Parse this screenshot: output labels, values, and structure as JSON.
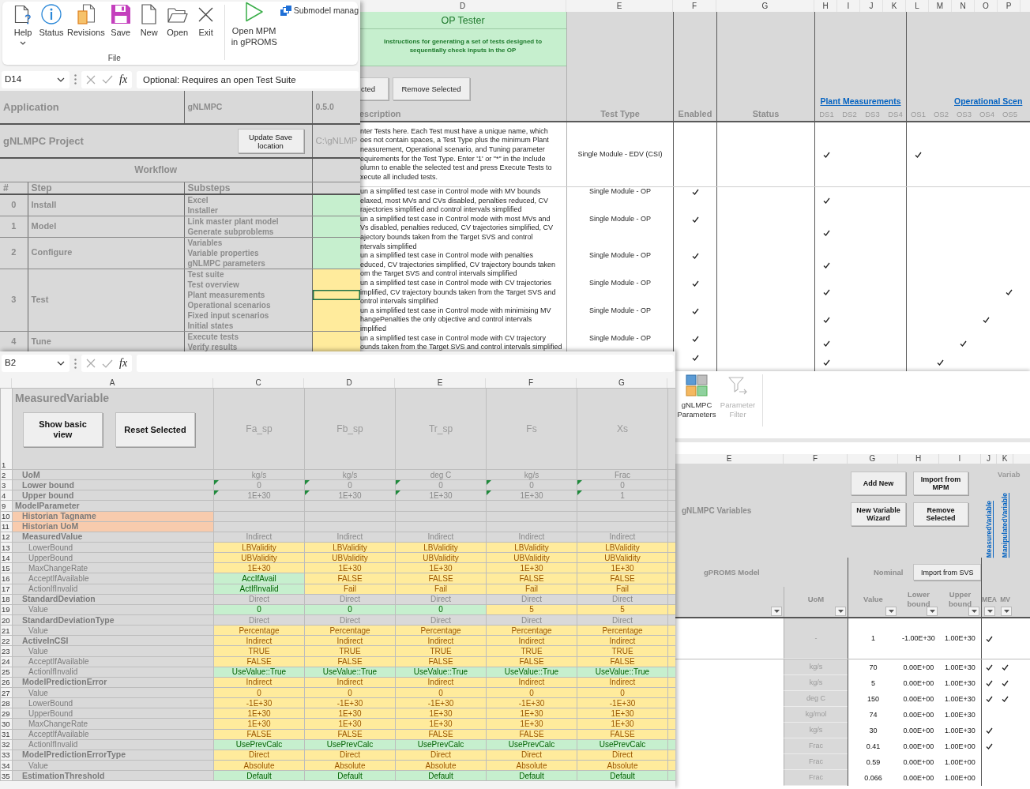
{
  "workflow_window": {
    "ribbon": {
      "commands": [
        {
          "kind": "help",
          "label": "Help",
          "dropdown": true
        },
        {
          "kind": "status",
          "label": "Status",
          "dropdown": false
        },
        {
          "kind": "revisions",
          "label": "Revisions",
          "dropdown": false
        },
        {
          "kind": "save",
          "label": "Save",
          "dropdown": false
        },
        {
          "kind": "new",
          "label": "New",
          "dropdown": false
        },
        {
          "kind": "open",
          "label": "Open",
          "dropdown": false
        },
        {
          "kind": "exit",
          "label": "Exit",
          "dropdown": false
        }
      ],
      "group_label": "File",
      "run_command": "Open MPM in gPROMS",
      "submodel_command": "Submodel manag"
    },
    "formula_bar": {
      "cell": "D14",
      "function_label": "fx",
      "formula": "Optional: Requires an open Test Suite"
    },
    "application_row": {
      "label": "Application",
      "value": "gNLMPC",
      "version": "0.5.0"
    },
    "project_row": {
      "label": "gNLMPC Project",
      "button": "Update Save location",
      "path": "C:\\gNLMP"
    },
    "section_title": "Workflow",
    "columns": [
      "#",
      "Step",
      "Substeps"
    ],
    "steps": [
      {
        "number": "0",
        "name": "Install",
        "color": "#c6efce",
        "substeps": [
          {
            "label": "Excel",
            "selected": false
          },
          {
            "label": "Installer",
            "selected": false
          }
        ]
      },
      {
        "number": "1",
        "name": "Model",
        "color": "#c6efce",
        "substeps": [
          {
            "label": "Link master plant model",
            "selected": false
          },
          {
            "label": "Generate subproblems",
            "selected": false
          }
        ]
      },
      {
        "number": "2",
        "name": "Configure",
        "color": "#c6efce",
        "substeps": [
          {
            "label": "Variables",
            "selected": false
          },
          {
            "label": "Variable properties",
            "selected": false
          },
          {
            "label": "gNLMPC parameters",
            "selected": false
          }
        ]
      },
      {
        "number": "3",
        "name": "Test",
        "color": "#ffeb9c",
        "substeps": [
          {
            "label": "Test suite",
            "selected": false
          },
          {
            "label": "Test overview",
            "selected": false
          },
          {
            "label": "Plant measurements",
            "selected": true
          },
          {
            "label": "Operational scenarios",
            "selected": false
          },
          {
            "label": "Fixed input scenarios",
            "selected": false
          },
          {
            "label": "Initial states",
            "selected": false
          }
        ]
      },
      {
        "number": "4",
        "name": "Tune",
        "color": "#ffeb9c",
        "substeps": [
          {
            "label": "Execute tests",
            "selected": false
          },
          {
            "label": "Verify results",
            "selected": false
          }
        ]
      }
    ]
  },
  "test_window": {
    "column_letters": [
      "D",
      "E",
      "F",
      "G",
      "H",
      "I",
      "J",
      "K",
      "L",
      "M",
      "N",
      "O",
      "P"
    ],
    "title": "OP Tester",
    "instructions": "Instructions for generating a set of tests designed to sequentially check inputs in the OP",
    "buttons": [
      "cted",
      "Remove Selected"
    ],
    "headers": {
      "description": "escription",
      "test_type": "Test Type",
      "enabled": "Enabled",
      "status": "Status"
    },
    "plant_link": "Plant Measurements",
    "plant_columns": [
      "DS1",
      "DS2",
      "DS3",
      "DS4"
    ],
    "scenario_link": "Operational Scen",
    "scenario_columns": [
      "OS1",
      "OS2",
      "OS3",
      "OS4",
      "OS5"
    ],
    "tests": [
      {
        "description": [
          "nter Tests here. Each Test must have a unique name, which",
          "oes not contain spaces, a Test Type plus the minimum Plant",
          "neasurement, Operational scenario, and Tuning parameter",
          "equirements for the Test Type. Enter '1' or \"*\" in the Include",
          "olumn to enable the selected test and press Execute Tests to",
          "xecute all included tests."
        ],
        "test_type": "Single Module - EDV (CSI)",
        "enabled": false,
        "plant": [
          true,
          false,
          false,
          false
        ],
        "scenarios": [
          true,
          false,
          false,
          false,
          false
        ]
      },
      {
        "description": [
          "un a simplified test case in Control mode with MV bounds",
          "elaxed, most MVs and CVs disabled, penalties reduced, CV",
          "rajectories simplified and control intervals simplified"
        ],
        "test_type": "Single Module - OP",
        "enabled": true,
        "plant": [
          true,
          false,
          false,
          false
        ],
        "scenarios": [
          false,
          false,
          false,
          false,
          false
        ]
      },
      {
        "description": [
          "un a simplified test case in Control mode with most MVs and",
          "Vs disabled, penalties reduced, CV trajectories simplified, CV",
          "ajectory bounds taken from the Target SVS and control",
          "ntervals simplified"
        ],
        "test_type": "Single Module - OP",
        "enabled": true,
        "plant": [
          true,
          false,
          false,
          false
        ],
        "scenarios": [
          false,
          false,
          false,
          false,
          false
        ]
      },
      {
        "description": [
          "un a simplified test case in Control mode with penalties",
          "educed, CV trajectories simplified, CV trajectory bounds taken",
          "om the Target SVS and control intervals simplified"
        ],
        "test_type": "Single Module - OP",
        "enabled": true,
        "plant": [
          true,
          false,
          false,
          false
        ],
        "scenarios": [
          false,
          false,
          false,
          false,
          false
        ]
      },
      {
        "description": [
          "un a simplified test case in Control mode with CV trajectories",
          "implified, CV trajectory bounds taken from the Target SVS and",
          "ontrol intervals simplified"
        ],
        "test_type": "Single Module - OP",
        "enabled": true,
        "plant": [
          true,
          false,
          false,
          false
        ],
        "scenarios": [
          false,
          false,
          false,
          false,
          true
        ]
      },
      {
        "description": [
          "un a simplified test case in Control mode with minimising MV",
          "hangePenalties the only objective and control intervals",
          "implified"
        ],
        "test_type": "Single Module - OP",
        "enabled": true,
        "plant": [
          true,
          false,
          false,
          false
        ],
        "scenarios": [
          false,
          false,
          false,
          true,
          false
        ]
      },
      {
        "description": [
          "un a simplified test case in Control mode with CV trajectory",
          "ounds taken from the Target SVS and control intervals simplified"
        ],
        "test_type": "Single Module - OP",
        "enabled": true,
        "plant": [
          true,
          false,
          false,
          false
        ],
        "scenarios": [
          false,
          false,
          true,
          false,
          false
        ]
      },
      {
        "enabled": true,
        "plant": [
          true,
          false,
          false,
          false
        ],
        "scenarios": [
          false,
          true,
          false,
          false,
          false
        ]
      }
    ]
  },
  "variable_window": {
    "formula_bar": {
      "cell": "B2",
      "function_label": "fx"
    },
    "column_letters": [
      "A",
      "C",
      "D",
      "E",
      "F",
      "G"
    ],
    "header_row_number": "1",
    "title": "MeasuredVariable",
    "buttons": [
      "Show basic view",
      "Reset Selected"
    ],
    "variables": [
      "Fa_sp",
      "Fb_sp",
      "Tr_sp",
      "Fs",
      "Xs"
    ],
    "rows": [
      {
        "number": "2",
        "label": "UoM",
        "kind": "property",
        "flagged": false,
        "cells": [
          {
            "text": "kg/s",
            "color": "#d9d9d9"
          },
          {
            "text": "kg/s",
            "color": "#d9d9d9"
          },
          {
            "text": "deg C",
            "color": "#d9d9d9"
          },
          {
            "text": "kg/s",
            "color": "#d9d9d9"
          },
          {
            "text": "Frac",
            "color": "#d9d9d9"
          }
        ]
      },
      {
        "number": "3",
        "label": "Lower bound",
        "kind": "property",
        "flagged": true,
        "cells": [
          {
            "text": "0",
            "color": "#d9d9d9"
          },
          {
            "text": "0",
            "color": "#d9d9d9"
          },
          {
            "text": "0",
            "color": "#d9d9d9"
          },
          {
            "text": "0",
            "color": "#d9d9d9"
          },
          {
            "text": "0",
            "color": "#d9d9d9"
          }
        ]
      },
      {
        "number": "4",
        "label": "Upper bound",
        "kind": "property",
        "flagged": true,
        "cells": [
          {
            "text": "1E+30",
            "color": "#d9d9d9"
          },
          {
            "text": "1E+30",
            "color": "#d9d9d9"
          },
          {
            "text": "1E+30",
            "color": "#d9d9d9"
          },
          {
            "text": "1E+30",
            "color": "#d9d9d9"
          },
          {
            "text": "1",
            "color": "#d9d9d9"
          }
        ]
      },
      {
        "number": "9",
        "label": "ModelParameter",
        "kind": "heading",
        "flagged": false
      },
      {
        "number": "10",
        "label": "Historian Tagname",
        "kind": "property",
        "flagged": false,
        "color": "#f8cbad"
      },
      {
        "number": "11",
        "label": "Historian UoM",
        "kind": "property",
        "flagged": false,
        "color": "#f8cbad"
      },
      {
        "number": "12",
        "label": "MeasuredValue",
        "kind": "property",
        "flagged": false,
        "cells": [
          {
            "text": "Indirect",
            "color": "#d9d9d9"
          },
          {
            "text": "Indirect",
            "color": "#d9d9d9"
          },
          {
            "text": "Indirect",
            "color": "#d9d9d9"
          },
          {
            "text": "Indirect",
            "color": "#d9d9d9"
          },
          {
            "text": "Indirect",
            "color": "#d9d9d9"
          }
        ]
      },
      {
        "number": "13",
        "label": "LowerBound",
        "kind": "field",
        "flagged": false,
        "cells": [
          {
            "text": "LBValidity",
            "color": "#ffeb9c"
          },
          {
            "text": "LBValidity",
            "color": "#ffeb9c"
          },
          {
            "text": "LBValidity",
            "color": "#ffeb9c"
          },
          {
            "text": "LBValidity",
            "color": "#ffeb9c"
          },
          {
            "text": "LBValidity",
            "color": "#ffeb9c"
          }
        ]
      },
      {
        "number": "14",
        "label": "UpperBound",
        "kind": "field",
        "flagged": false,
        "cells": [
          {
            "text": "UBValidity",
            "color": "#ffeb9c"
          },
          {
            "text": "UBValidity",
            "color": "#ffeb9c"
          },
          {
            "text": "UBValidity",
            "color": "#ffeb9c"
          },
          {
            "text": "UBValidity",
            "color": "#ffeb9c"
          },
          {
            "text": "UBValidity",
            "color": "#ffeb9c"
          }
        ]
      },
      {
        "number": "15",
        "label": "MaxChangeRate",
        "kind": "field",
        "flagged": false,
        "cells": [
          {
            "text": "1E+30",
            "color": "#ffeb9c"
          },
          {
            "text": "1E+30",
            "color": "#ffeb9c"
          },
          {
            "text": "1E+30",
            "color": "#ffeb9c"
          },
          {
            "text": "1E+30",
            "color": "#ffeb9c"
          },
          {
            "text": "1E+30",
            "color": "#ffeb9c"
          }
        ]
      },
      {
        "number": "16",
        "label": "AcceptIfAvailable",
        "kind": "field",
        "flagged": false,
        "cells": [
          {
            "text": "AccIfAvail",
            "color": "#c6efce"
          },
          {
            "text": "FALSE",
            "color": "#ffeb9c"
          },
          {
            "text": "FALSE",
            "color": "#ffeb9c"
          },
          {
            "text": "FALSE",
            "color": "#ffeb9c"
          },
          {
            "text": "FALSE",
            "color": "#ffeb9c"
          }
        ]
      },
      {
        "number": "17",
        "label": "ActionIfInvalid",
        "kind": "field",
        "flagged": false,
        "cells": [
          {
            "text": "ActIfInvalid",
            "color": "#c6efce"
          },
          {
            "text": "Fail",
            "color": "#ffeb9c"
          },
          {
            "text": "Fail",
            "color": "#ffeb9c"
          },
          {
            "text": "Fail",
            "color": "#ffeb9c"
          },
          {
            "text": "Fail",
            "color": "#ffeb9c"
          }
        ]
      },
      {
        "number": "18",
        "label": "StandardDeviation",
        "kind": "property",
        "flagged": false,
        "cells": [
          {
            "text": "Direct",
            "color": "#d9d9d9"
          },
          {
            "text": "Direct",
            "color": "#d9d9d9"
          },
          {
            "text": "Direct",
            "color": "#d9d9d9"
          },
          {
            "text": "Direct",
            "color": "#d9d9d9"
          },
          {
            "text": "Direct",
            "color": "#d9d9d9"
          }
        ]
      },
      {
        "number": "19",
        "label": "Value",
        "kind": "field",
        "flagged": false,
        "cells": [
          {
            "text": "0",
            "color": "#c6efce"
          },
          {
            "text": "0",
            "color": "#c6efce"
          },
          {
            "text": "0",
            "color": "#c6efce"
          },
          {
            "text": "5",
            "color": "#ffeb9c"
          },
          {
            "text": "5",
            "color": "#ffeb9c"
          }
        ]
      },
      {
        "number": "20",
        "label": "StandardDeviationType",
        "kind": "property",
        "flagged": false,
        "cells": [
          {
            "text": "Direct",
            "color": "#d9d9d9"
          },
          {
            "text": "Direct",
            "color": "#d9d9d9"
          },
          {
            "text": "Direct",
            "color": "#d9d9d9"
          },
          {
            "text": "Direct",
            "color": "#d9d9d9"
          },
          {
            "text": "Direct",
            "color": "#d9d9d9"
          }
        ]
      },
      {
        "number": "21",
        "label": "Value",
        "kind": "field",
        "flagged": false,
        "cells": [
          {
            "text": "Percentage",
            "color": "#ffeb9c"
          },
          {
            "text": "Percentage",
            "color": "#ffeb9c"
          },
          {
            "text": "Percentage",
            "color": "#ffeb9c"
          },
          {
            "text": "Percentage",
            "color": "#ffeb9c"
          },
          {
            "text": "Percentage",
            "color": "#ffeb9c"
          }
        ]
      },
      {
        "number": "22",
        "label": "ActiveInCSI",
        "kind": "property",
        "flagged": false,
        "cells": [
          {
            "text": "Indirect",
            "color": "#ffeb9c"
          },
          {
            "text": "Indirect",
            "color": "#ffeb9c"
          },
          {
            "text": "Indirect",
            "color": "#ffeb9c"
          },
          {
            "text": "Indirect",
            "color": "#ffeb9c"
          },
          {
            "text": "Indirect",
            "color": "#ffeb9c"
          }
        ]
      },
      {
        "number": "23",
        "label": "Value",
        "kind": "field",
        "flagged": false,
        "cells": [
          {
            "text": "TRUE",
            "color": "#ffeb9c"
          },
          {
            "text": "TRUE",
            "color": "#ffeb9c"
          },
          {
            "text": "TRUE",
            "color": "#ffeb9c"
          },
          {
            "text": "TRUE",
            "color": "#ffeb9c"
          },
          {
            "text": "TRUE",
            "color": "#ffeb9c"
          }
        ]
      },
      {
        "number": "24",
        "label": "AcceptIfAvailable",
        "kind": "field",
        "flagged": false,
        "cells": [
          {
            "text": "FALSE",
            "color": "#ffeb9c"
          },
          {
            "text": "FALSE",
            "color": "#ffeb9c"
          },
          {
            "text": "FALSE",
            "color": "#ffeb9c"
          },
          {
            "text": "FALSE",
            "color": "#ffeb9c"
          },
          {
            "text": "FALSE",
            "color": "#ffeb9c"
          }
        ]
      },
      {
        "number": "25",
        "label": "ActionIfInvalid",
        "kind": "field",
        "flagged": false,
        "cells": [
          {
            "text": "UseValue::True",
            "color": "#c6efce"
          },
          {
            "text": "UseValue::True",
            "color": "#c6efce"
          },
          {
            "text": "UseValue::True",
            "color": "#c6efce"
          },
          {
            "text": "UseValue::True",
            "color": "#c6efce"
          },
          {
            "text": "UseValue::True",
            "color": "#c6efce"
          }
        ]
      },
      {
        "number": "26",
        "label": "ModelPredictionError",
        "kind": "property",
        "flagged": false,
        "cells": [
          {
            "text": "Indirect",
            "color": "#ffeb9c"
          },
          {
            "text": "Indirect",
            "color": "#ffeb9c"
          },
          {
            "text": "Indirect",
            "color": "#ffeb9c"
          },
          {
            "text": "Indirect",
            "color": "#ffeb9c"
          },
          {
            "text": "Indirect",
            "color": "#ffeb9c"
          }
        ]
      },
      {
        "number": "27",
        "label": "Value",
        "kind": "field",
        "flagged": false,
        "cells": [
          {
            "text": "0",
            "color": "#ffeb9c"
          },
          {
            "text": "0",
            "color": "#ffeb9c"
          },
          {
            "text": "0",
            "color": "#ffeb9c"
          },
          {
            "text": "0",
            "color": "#ffeb9c"
          },
          {
            "text": "0",
            "color": "#ffeb9c"
          }
        ]
      },
      {
        "number": "28",
        "label": "LowerBound",
        "kind": "field",
        "flagged": false,
        "cells": [
          {
            "text": "-1E+30",
            "color": "#ffeb9c"
          },
          {
            "text": "-1E+30",
            "color": "#ffeb9c"
          },
          {
            "text": "-1E+30",
            "color": "#ffeb9c"
          },
          {
            "text": "-1E+30",
            "color": "#ffeb9c"
          },
          {
            "text": "-1E+30",
            "color": "#ffeb9c"
          }
        ]
      },
      {
        "number": "29",
        "label": "UpperBound",
        "kind": "field",
        "flagged": false,
        "cells": [
          {
            "text": "1E+30",
            "color": "#ffeb9c"
          },
          {
            "text": "1E+30",
            "color": "#ffeb9c"
          },
          {
            "text": "1E+30",
            "color": "#ffeb9c"
          },
          {
            "text": "1E+30",
            "color": "#ffeb9c"
          },
          {
            "text": "1E+30",
            "color": "#ffeb9c"
          }
        ]
      },
      {
        "number": "30",
        "label": "MaxChangeRate",
        "kind": "field",
        "flagged": false,
        "cells": [
          {
            "text": "1E+30",
            "color": "#ffeb9c"
          },
          {
            "text": "1E+30",
            "color": "#ffeb9c"
          },
          {
            "text": "1E+30",
            "color": "#ffeb9c"
          },
          {
            "text": "1E+30",
            "color": "#ffeb9c"
          },
          {
            "text": "1E+30",
            "color": "#ffeb9c"
          }
        ]
      },
      {
        "number": "31",
        "label": "AcceptIfAvailable",
        "kind": "field",
        "flagged": false,
        "cells": [
          {
            "text": "FALSE",
            "color": "#ffeb9c"
          },
          {
            "text": "FALSE",
            "color": "#ffeb9c"
          },
          {
            "text": "FALSE",
            "color": "#ffeb9c"
          },
          {
            "text": "FALSE",
            "color": "#ffeb9c"
          },
          {
            "text": "FALSE",
            "color": "#ffeb9c"
          }
        ]
      },
      {
        "number": "32",
        "label": "ActionIfInvalid",
        "kind": "field",
        "flagged": false,
        "cells": [
          {
            "text": "UsePrevCalc",
            "color": "#c6efce"
          },
          {
            "text": "UsePrevCalc",
            "color": "#c6efce"
          },
          {
            "text": "UsePrevCalc",
            "color": "#c6efce"
          },
          {
            "text": "UsePrevCalc",
            "color": "#c6efce"
          },
          {
            "text": "UsePrevCalc",
            "color": "#c6efce"
          }
        ]
      },
      {
        "number": "33",
        "label": "ModelPredictionErrorType",
        "kind": "property",
        "flagged": false,
        "cells": [
          {
            "text": "Direct",
            "color": "#ffeb9c"
          },
          {
            "text": "Direct",
            "color": "#ffeb9c"
          },
          {
            "text": "Direct",
            "color": "#ffeb9c"
          },
          {
            "text": "Direct",
            "color": "#ffeb9c"
          },
          {
            "text": "Direct",
            "color": "#ffeb9c"
          }
        ]
      },
      {
        "number": "34",
        "label": "Value",
        "kind": "field",
        "flagged": false,
        "cells": [
          {
            "text": "Absolute",
            "color": "#ffeb9c"
          },
          {
            "text": "Absolute",
            "color": "#ffeb9c"
          },
          {
            "text": "Absolute",
            "color": "#ffeb9c"
          },
          {
            "text": "Absolute",
            "color": "#ffeb9c"
          },
          {
            "text": "Absolute",
            "color": "#ffeb9c"
          }
        ]
      },
      {
        "number": "35",
        "label": "EstimationThreshold",
        "kind": "property",
        "flagged": false,
        "cells": [
          {
            "text": "Default",
            "color": "#c6efce"
          },
          {
            "text": "Default",
            "color": "#c6efce"
          },
          {
            "text": "Default",
            "color": "#c6efce"
          },
          {
            "text": "Default",
            "color": "#c6efce"
          },
          {
            "text": "Default",
            "color": "#c6efce"
          }
        ]
      }
    ]
  },
  "variables_window": {
    "ribbon": [
      {
        "kind": "parameters",
        "label": "gNLMPC Parameters",
        "disabled": false
      },
      {
        "kind": "filter",
        "label": "Parameter Filter",
        "disabled": true
      }
    ],
    "column_letters": [
      "E",
      "F",
      "G",
      "H",
      "I",
      "J",
      "K"
    ],
    "title": "gNLMPC Variables",
    "buttons": [
      "Add New",
      "Import from MPM",
      "New Variable Wizard",
      "Remove Selected"
    ],
    "corner_text": "Variab",
    "sheet_links": [
      "MeasuredVariable",
      "ManipulatedVariable"
    ],
    "model_header": "gPROMS Model",
    "nominal_header": "Nominal",
    "import_button": "Import from SVS",
    "columns": [
      "UoM",
      "Value",
      "Lower bound",
      "Upper bound",
      "MEA",
      "MV"
    ],
    "rows": [
      {
        "uom": "-",
        "value": "1",
        "lower": "-1.00E+30",
        "upper": "1.00E+30",
        "mea": true,
        "mv": false
      },
      {
        "uom": "kg/s",
        "value": "70",
        "lower": "0.00E+00",
        "upper": "1.00E+30",
        "mea": true,
        "mv": true
      },
      {
        "uom": "kg/s",
        "value": "5",
        "lower": "0.00E+00",
        "upper": "1.00E+30",
        "mea": true,
        "mv": true
      },
      {
        "uom": "deg C",
        "value": "150",
        "lower": "0.00E+00",
        "upper": "1.00E+30",
        "mea": true,
        "mv": true
      },
      {
        "uom": "kg/mol",
        "value": "74",
        "lower": "0.00E+00",
        "upper": "1.00E+30",
        "mea": false,
        "mv": false
      },
      {
        "uom": "kg/s",
        "value": "30",
        "lower": "0.00E+00",
        "upper": "1.00E+30",
        "mea": true,
        "mv": false
      },
      {
        "uom": "Frac",
        "value": "0.41",
        "lower": "0.00E+00",
        "upper": "1.00E+00",
        "mea": true,
        "mv": false
      },
      {
        "uom": "Frac",
        "value": "0.59",
        "lower": "0.00E+00",
        "upper": "1.00E+00",
        "mea": false,
        "mv": false
      },
      {
        "uom": "Frac",
        "value": "0.066",
        "lower": "0.00E+00",
        "upper": "1.00E+00",
        "mea": false,
        "mv": false
      }
    ]
  }
}
